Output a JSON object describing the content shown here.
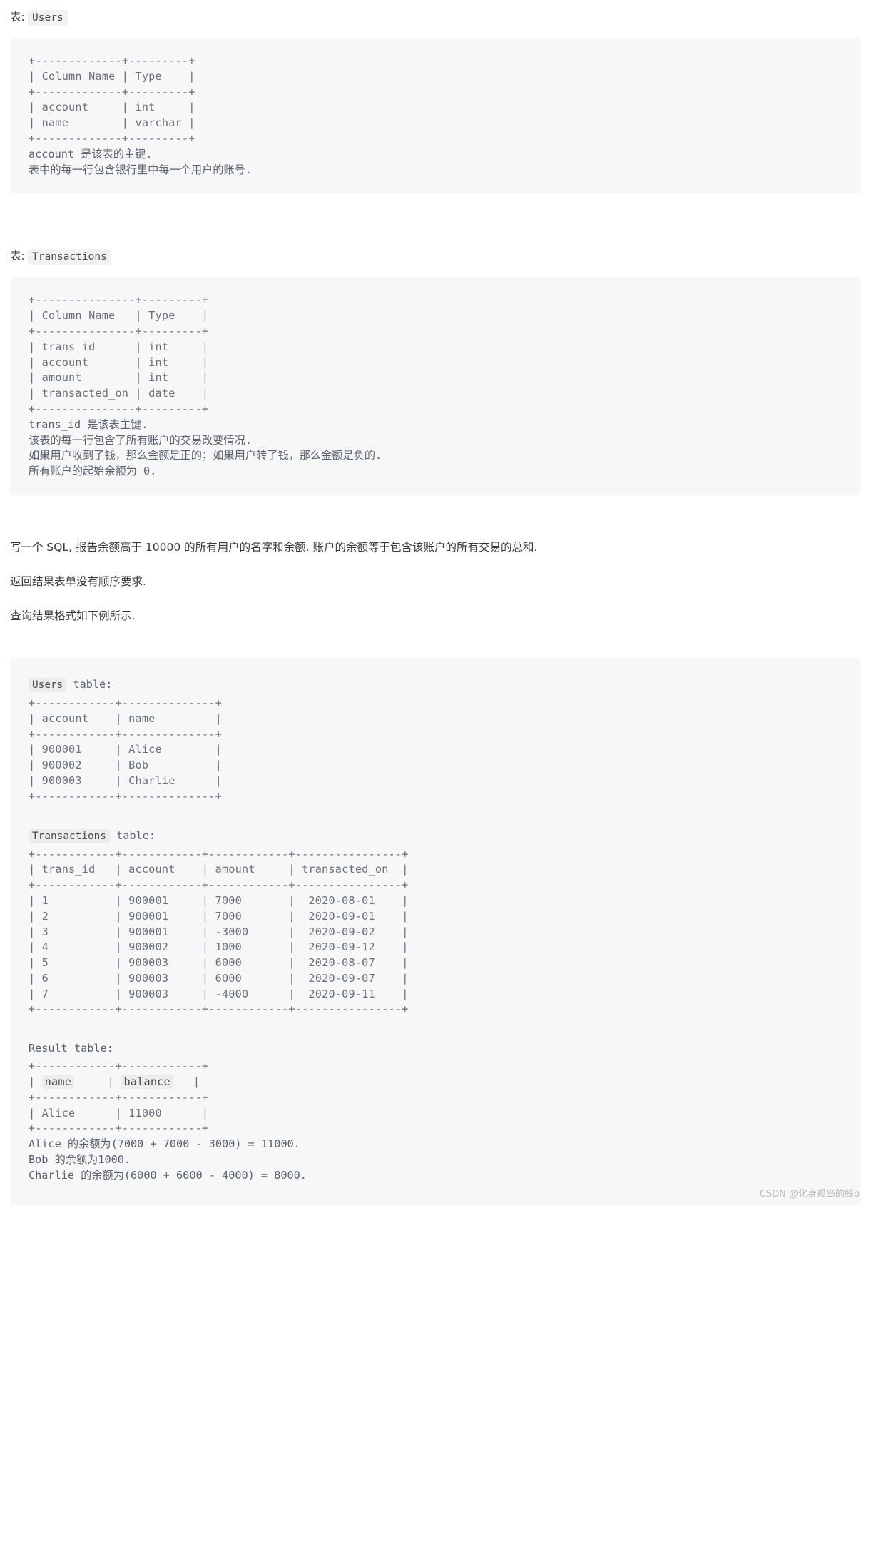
{
  "colors": {
    "page_bg": "#ffffff",
    "code_bg": "#f7f7f7",
    "chip_bg": "#ececec",
    "code_text": "#6a6f7a",
    "body_text": "#3a3a3a",
    "watermark": "#b9b9b9"
  },
  "sections": {
    "users_label_prefix": "表:",
    "users_label_code": "Users",
    "transactions_label_prefix": "表:",
    "transactions_label_code": "Transactions"
  },
  "users_schema": {
    "ascii": "+-------------+---------+\n| Column Name | Type    |\n+-------------+---------+\n| account     | int     |\n| name        | varchar |\n+-------------+---------+",
    "notes": "account 是该表的主键.\n表中的每一行包含银行里中每一个用户的账号."
  },
  "transactions_schema": {
    "ascii": "+---------------+---------+\n| Column Name   | Type    |\n+---------------+---------+\n| trans_id      | int     |\n| account       | int     |\n| amount        | int     |\n| transacted_on | date    |\n+---------------+---------+",
    "notes": "trans_id 是该表主键.\n该表的每一行包含了所有账户的交易改变情况.\n如果用户收到了钱，那么金额是正的；如果用户转了钱，那么金额是负的.\n所有账户的起始余额为 0."
  },
  "prose": {
    "p1": "写一个 SQL, 报告余额高于 10000 的所有用户的名字和余额. 账户的余额等于包含该账户的所有交易的总和.",
    "p2": "返回结果表单没有顺序要求.",
    "p3": "查询结果格式如下例所示."
  },
  "example": {
    "users_table_chip": "Users",
    "users_table_suffix": "table:",
    "users_ascii": "+------------+--------------+\n| account    | name         |\n+------------+--------------+\n| 900001     | Alice        |\n| 900002     | Bob          |\n| 900003     | Charlie      |\n+------------+--------------+",
    "transactions_table_chip": "Transactions",
    "transactions_table_suffix": "table:",
    "transactions_ascii": "+------------+------------+------------+----------------+\n| trans_id   | account    | amount     | transacted_on  |\n+------------+------------+------------+----------------+\n| 1          | 900001     | 7000       |  2020-08-01    |\n| 2          | 900001     | 7000       |  2020-09-01    |\n| 3          | 900001     | -3000      |  2020-09-02    |\n| 4          | 900002     | 1000       |  2020-09-12    |\n| 5          | 900003     | 6000       |  2020-08-07    |\n| 6          | 900003     | 6000       |  2020-09-07    |\n| 7          | 900003     | -4000      |  2020-09-11    |\n+------------+------------+------------+----------------+",
    "result_title": "Result table:",
    "result_rule_top": "+------------+------------+",
    "result_header_name": "name",
    "result_header_balance": "balance",
    "result_rule_mid": "+------------+------------+",
    "result_row": "| Alice      | 11000      |",
    "result_rule_bottom": "+------------+------------+",
    "explanation": "Alice 的余额为(7000 + 7000 - 3000) = 11000.\nBob 的余额为1000.\nCharlie 的余额为(6000 + 6000 - 4000) = 8000."
  },
  "chart_data": {
    "type": "table",
    "title": "Users / Transactions example data",
    "tables": [
      {
        "name": "Users",
        "columns": [
          "account",
          "name"
        ],
        "rows": [
          [
            "900001",
            "Alice"
          ],
          [
            "900002",
            "Bob"
          ],
          [
            "900003",
            "Charlie"
          ]
        ]
      },
      {
        "name": "Transactions",
        "columns": [
          "trans_id",
          "account",
          "amount",
          "transacted_on"
        ],
        "rows": [
          [
            "1",
            "900001",
            "7000",
            "2020-08-01"
          ],
          [
            "2",
            "900001",
            "7000",
            "2020-09-01"
          ],
          [
            "3",
            "900001",
            "-3000",
            "2020-09-02"
          ],
          [
            "4",
            "900002",
            "1000",
            "2020-09-12"
          ],
          [
            "5",
            "900003",
            "6000",
            "2020-08-07"
          ],
          [
            "6",
            "900003",
            "6000",
            "2020-09-07"
          ],
          [
            "7",
            "900003",
            "-4000",
            "2020-09-11"
          ]
        ]
      },
      {
        "name": "Result",
        "columns": [
          "name",
          "balance"
        ],
        "rows": [
          [
            "Alice",
            "11000"
          ]
        ]
      }
    ],
    "schemas": [
      {
        "name": "Users",
        "columns": [
          {
            "Column Name": "account",
            "Type": "int"
          },
          {
            "Column Name": "name",
            "Type": "varchar"
          }
        ]
      },
      {
        "name": "Transactions",
        "columns": [
          {
            "Column Name": "trans_id",
            "Type": "int"
          },
          {
            "Column Name": "account",
            "Type": "int"
          },
          {
            "Column Name": "amount",
            "Type": "int"
          },
          {
            "Column Name": "transacted_on",
            "Type": "date"
          }
        ]
      }
    ]
  },
  "watermark": "CSDN @化身孤岛的鲸o"
}
